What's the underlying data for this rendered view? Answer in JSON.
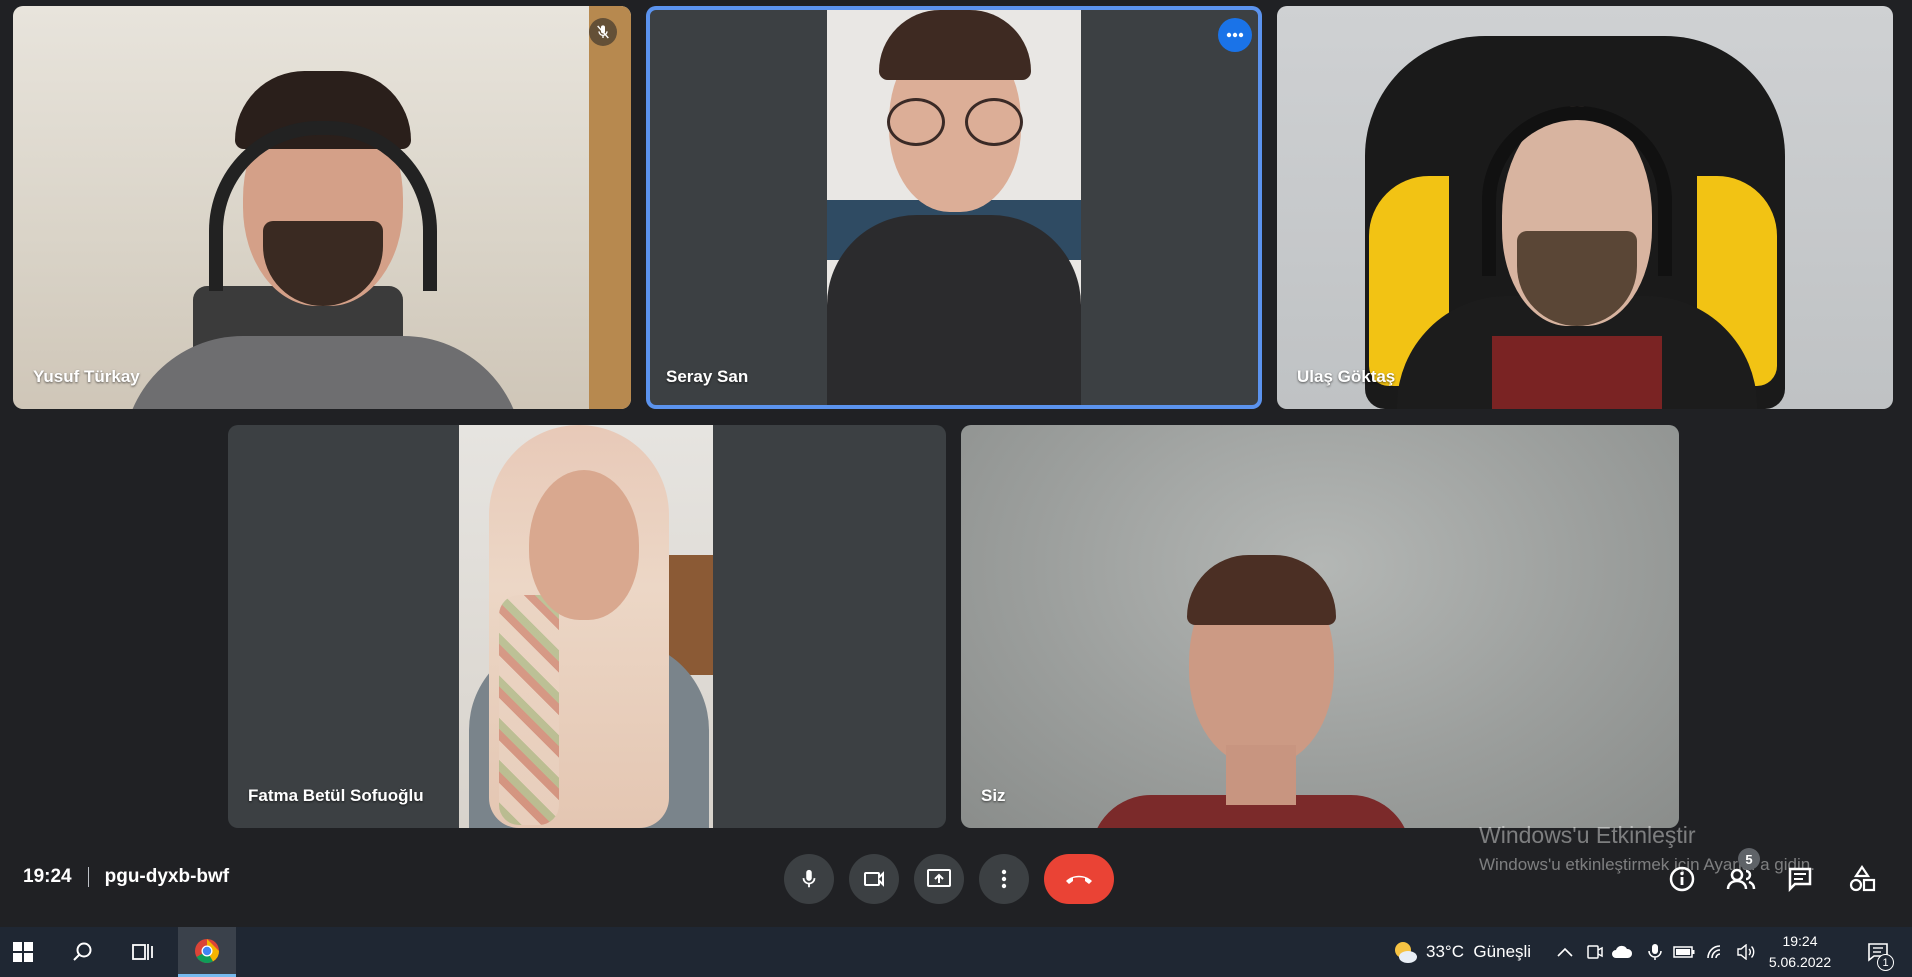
{
  "participants": {
    "tile1": {
      "name": "Yusuf Türkay"
    },
    "tile2": {
      "name": "Seray San"
    },
    "tile3": {
      "name": "Ulaş Göktaş"
    },
    "tile4": {
      "name": "Fatma Betül Sofuoğlu"
    },
    "tile5": {
      "name": "Siz"
    }
  },
  "meeting": {
    "time": "19:24",
    "code": "pgu-dyxb-bwf",
    "participant_count": "5"
  },
  "watermark": {
    "title": "Windows'u Etkinleştir",
    "subtitle": "Windows'u etkinleştirmek için Ayarlar'a gidin."
  },
  "taskbar": {
    "weather": "33°C  Güneşli",
    "clock_time": "19:24",
    "clock_date": "5.06.2022",
    "notification_count": "1"
  },
  "colors": {
    "background": "#202124",
    "tile": "#3c4043",
    "active_border": "#5b93ee",
    "end_call": "#ea4335",
    "taskbar": "#1f2733"
  }
}
